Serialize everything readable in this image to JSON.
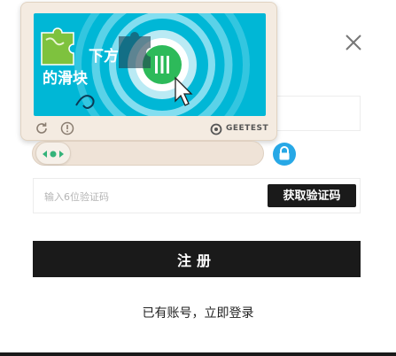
{
  "form": {
    "code_placeholder": "输入6位验证码",
    "get_code_button": "获取验证码",
    "register_button": "注册",
    "login_link": "已有账号，立即登录"
  },
  "captcha": {
    "instruction_line1": "下方",
    "instruction_line2": "的滑块",
    "brand": "GEETEST",
    "colors": {
      "image_bg": "#00b7d6",
      "lock": "#27a8e6",
      "panel": "#f4ebe1"
    }
  },
  "icons": [
    "close-icon",
    "refresh-icon",
    "info-icon",
    "geetest-logo-icon",
    "slider-arrows-icon",
    "lock-icon",
    "pointer-cursor-icon"
  ]
}
